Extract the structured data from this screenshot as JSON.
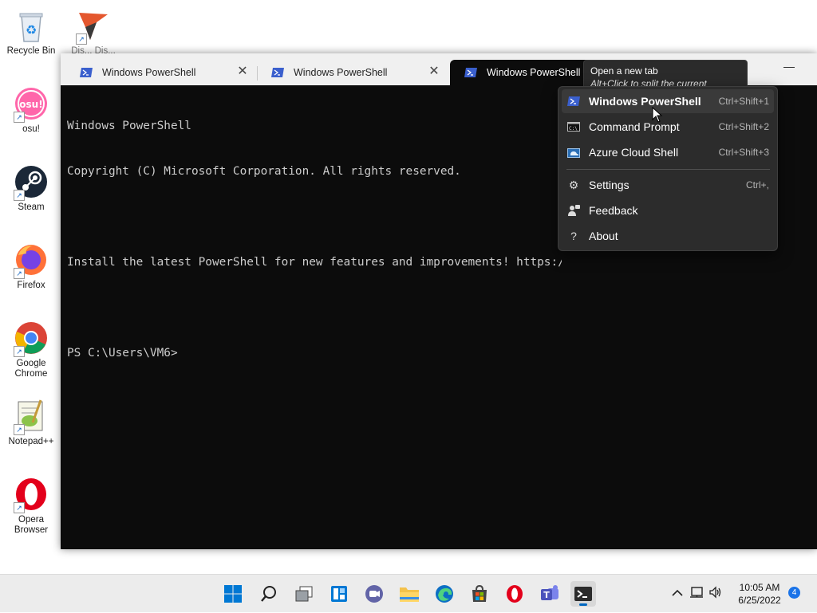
{
  "desktop": {
    "icons": [
      {
        "label": "Recycle Bin",
        "icon": "recycle-bin-icon"
      },
      {
        "label": "Dis... Dis...",
        "icon": "app-shortcut-icon"
      },
      {
        "label": "osu!",
        "icon": "osu-icon"
      },
      {
        "label": "Steam",
        "icon": "steam-icon"
      },
      {
        "label": "Firefox",
        "icon": "firefox-icon"
      },
      {
        "label": "Google Chrome",
        "icon": "chrome-icon"
      },
      {
        "label": "Notepad++",
        "icon": "notepadpp-icon"
      },
      {
        "label": "Opera Browser",
        "icon": "opera-icon"
      }
    ]
  },
  "terminal": {
    "tabs": [
      {
        "label": "Windows PowerShell",
        "active": false
      },
      {
        "label": "Windows PowerShell",
        "active": false
      },
      {
        "label": "Windows PowerShell",
        "active": true
      }
    ],
    "console_lines": [
      "Windows PowerShell",
      "Copyright (C) Microsoft Corporation. All rights reserved.",
      "",
      "Install the latest PowerShell for new features and improvements! https://aka.ms/PSWindows",
      "",
      "PS C:\\Users\\VM6>"
    ],
    "minimize_symbol": "—"
  },
  "tooltip": {
    "title": "Open a new tab",
    "subtitle": "Alt+Click to split the current window"
  },
  "menu": {
    "profiles": [
      {
        "label": "Windows PowerShell",
        "shortcut": "Ctrl+Shift+1",
        "icon": "powershell-icon"
      },
      {
        "label": "Command Prompt",
        "shortcut": "Ctrl+Shift+2",
        "icon": "cmd-icon"
      },
      {
        "label": "Azure Cloud Shell",
        "shortcut": "Ctrl+Shift+3",
        "icon": "azure-cloud-shell-icon"
      }
    ],
    "actions": [
      {
        "label": "Settings",
        "shortcut": "Ctrl+,",
        "icon": "gear-icon"
      },
      {
        "label": "Feedback",
        "shortcut": "",
        "icon": "feedback-icon"
      },
      {
        "label": "About",
        "shortcut": "",
        "icon": "question-icon"
      }
    ]
  },
  "taskbar": {
    "apps": [
      "start-icon",
      "search-icon",
      "task-view-icon",
      "widgets-icon",
      "chat-icon",
      "file-explorer-icon",
      "edge-icon",
      "store-icon",
      "opera-icon",
      "teams-icon",
      "terminal-icon"
    ],
    "clock": {
      "time": "10:05 AM",
      "date": "6/25/2022"
    },
    "notification_count": "4"
  },
  "colors": {
    "accent": "#0067c0",
    "terminal_bg": "#0c0c0c",
    "menu_bg": "#2c2c2c",
    "powershell_blue": "#3a5fcd"
  }
}
